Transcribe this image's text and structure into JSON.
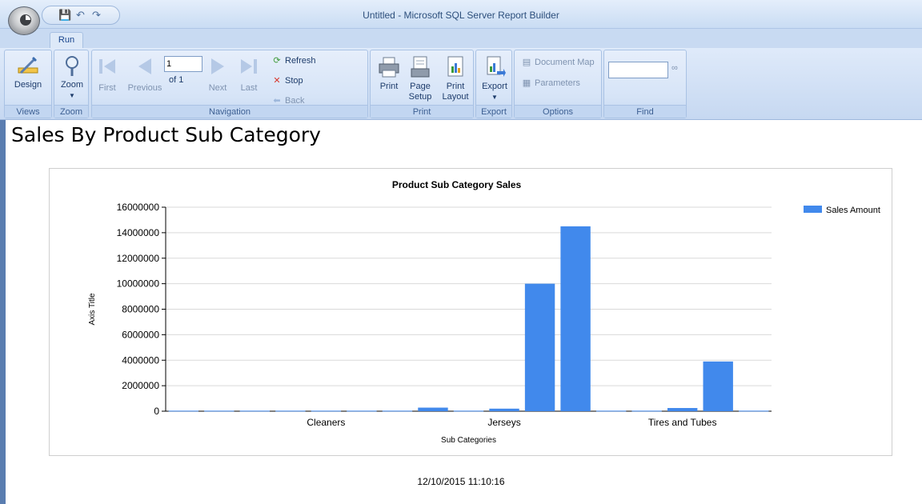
{
  "window": {
    "title": "Untitled - Microsoft SQL Server Report Builder"
  },
  "tabs": [
    {
      "label": "Run"
    }
  ],
  "ribbon": {
    "groups": {
      "views": {
        "label": "Views",
        "design_label": "Design"
      },
      "zoom": {
        "label": "Zoom",
        "zoom_label": "Zoom"
      },
      "navigation": {
        "label": "Navigation",
        "first_label": "First",
        "previous_label": "Previous",
        "page_value": "1",
        "of_label": "of 1",
        "next_label": "Next",
        "last_label": "Last",
        "refresh_label": "Refresh",
        "stop_label": "Stop",
        "back_label": "Back"
      },
      "print": {
        "label": "Print",
        "print_label": "Print",
        "page_setup_label1": "Page",
        "page_setup_label2": "Setup",
        "print_layout_label1": "Print",
        "print_layout_label2": "Layout"
      },
      "export": {
        "label": "Export",
        "export_label": "Export"
      },
      "options": {
        "label": "Options",
        "document_map_label": "Document Map",
        "parameters_label": "Parameters"
      },
      "find": {
        "label": "Find",
        "search_value": ""
      }
    }
  },
  "report": {
    "title": "Sales By Product Sub Category",
    "timestamp": "12/10/2015 11:10:16"
  },
  "colors": {
    "bar": "#4189ec",
    "ribbon_text": "#1e3c6b"
  },
  "chart_data": {
    "type": "bar",
    "title": "Product Sub Category Sales",
    "xlabel": "Sub Categories",
    "ylabel": "Axis Title",
    "ylim": [
      0,
      16000000
    ],
    "yticks": [
      0,
      2000000,
      4000000,
      6000000,
      8000000,
      10000000,
      12000000,
      14000000,
      16000000
    ],
    "x_tick_labels": [
      "Cleaners",
      "Jerseys",
      "Tires and Tubes"
    ],
    "categories": [
      "",
      "",
      "",
      "",
      "Cleaners",
      "",
      "",
      "",
      "",
      "Jerseys",
      "",
      "",
      "",
      "",
      "Tires and Tubes",
      "",
      ""
    ],
    "series": [
      {
        "name": "Sales Amount",
        "values": [
          40000,
          40000,
          40000,
          40000,
          40000,
          40000,
          40000,
          280000,
          40000,
          200000,
          10000000,
          14500000,
          40000,
          40000,
          250000,
          3900000,
          40000
        ]
      }
    ],
    "legend": "top-right",
    "grid": true
  }
}
